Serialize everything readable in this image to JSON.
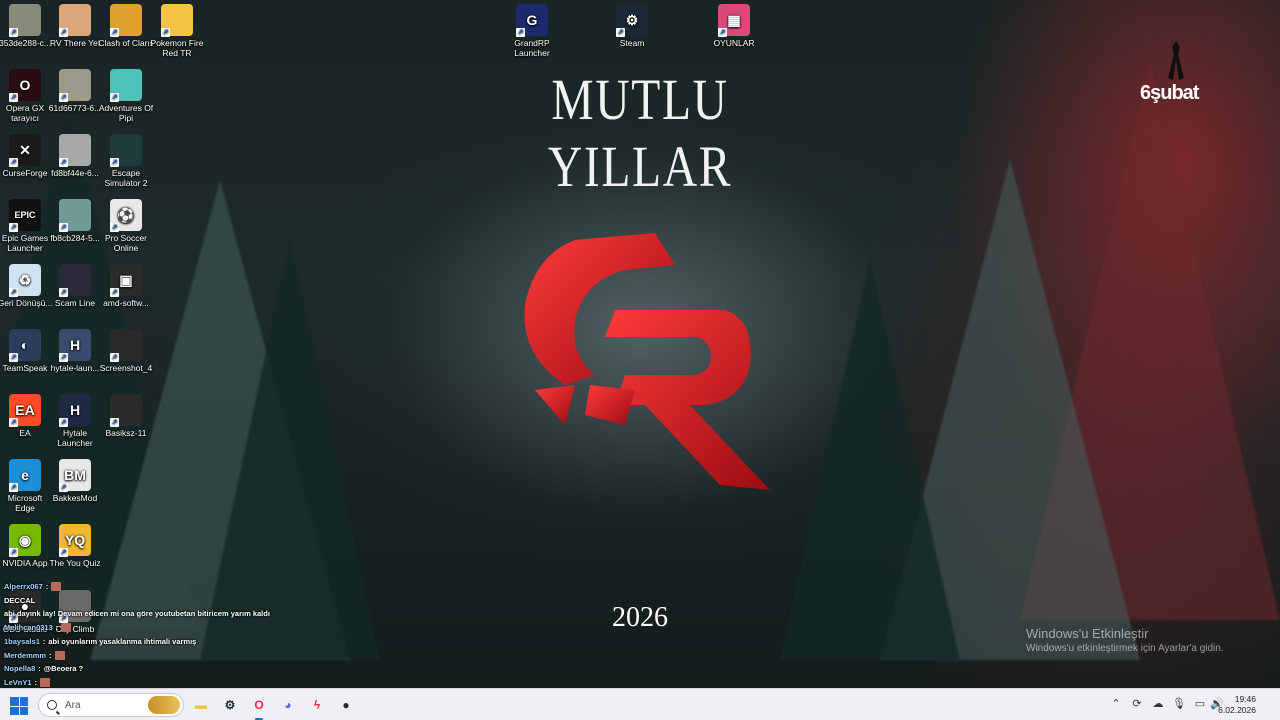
{
  "desktop": {
    "title": "MUTLU YILLAR",
    "year": "2026",
    "memorial": "6şubat",
    "activation": {
      "title": "Windows'u Etkinleştir",
      "subtitle": "Windows'u etkinleştirmek için Ayarlar'a gidin."
    },
    "icons": [
      {
        "label": "353de288-c...",
        "icon": "image-file-icon",
        "color": "#8a8a7a"
      },
      {
        "label": "RV There Yet",
        "icon": "rv-there-yet-icon",
        "color": "#d9a77a"
      },
      {
        "label": "Clash of Clans",
        "icon": "clash-of-clans-icon",
        "color": "#e0a030"
      },
      {
        "label": "Pokemon Fire Red TR",
        "icon": "folder-icon",
        "color": "#f3c443"
      },
      {
        "label": "Opera GX tarayıcı",
        "icon": "opera-gx-icon",
        "color": "#2a0d12"
      },
      {
        "label": "61d66773-6...",
        "icon": "image-file-icon",
        "color": "#9c9a8a"
      },
      {
        "label": "Adventures Of Pipi",
        "icon": "adventures-of-pipi-icon",
        "color": "#4cc2b8"
      },
      {
        "label": "CurseForge",
        "icon": "curseforge-icon",
        "color": "#1b1b1b"
      },
      {
        "label": "fd8bf44e-6...",
        "icon": "image-file-icon",
        "color": "#a8a8a8"
      },
      {
        "label": "Escape Simulator 2",
        "icon": "escape-simulator-icon",
        "color": "#1f3a3a"
      },
      {
        "label": "Epic Games Launcher",
        "icon": "epic-games-icon",
        "color": "#111111"
      },
      {
        "label": "fb8cb284-5...",
        "icon": "image-file-icon",
        "color": "#6f9a98"
      },
      {
        "label": "Pro Soccer Online",
        "icon": "soccer-ball-icon",
        "color": "#e8e8e8"
      },
      {
        "label": "Geri Dönüşü...",
        "icon": "recycle-bin-icon",
        "color": "#cfe3f2"
      },
      {
        "label": "Scam Line",
        "icon": "scam-line-icon",
        "color": "#2a2a3a"
      },
      {
        "label": "amd-softw...",
        "icon": "amd-installer-icon",
        "color": "#2b2b2b"
      },
      {
        "label": "TeamSpeak",
        "icon": "teamspeak-icon",
        "color": "#2b3d5a"
      },
      {
        "label": "hytale-laun...",
        "icon": "hytale-installer-icon",
        "color": "#3a4a6a"
      },
      {
        "label": "Screenshot_4",
        "icon": "image-file-icon",
        "color": "#2a2a2a"
      },
      {
        "label": "EA",
        "icon": "ea-icon",
        "color": "#ff4b26"
      },
      {
        "label": "Hytale Launcher",
        "icon": "hytale-icon",
        "color": "#1e2a44"
      },
      {
        "label": "Basiksz-11",
        "icon": "image-file-icon",
        "color": "#2a2a2a"
      },
      {
        "label": "Microsoft Edge",
        "icon": "edge-icon",
        "color": "#1d8fd8"
      },
      {
        "label": "BakkesMod",
        "icon": "bakkesmod-icon",
        "color": "#e8e8e8"
      },
      {
        "label": "NVIDIA App",
        "icon": "nvidia-icon",
        "color": "#76b900"
      },
      {
        "label": "The You Quiz",
        "icon": "you-quiz-icon",
        "color": "#f2b632"
      },
      {
        "label": "OBS Studio",
        "icon": "obs-icon",
        "color": "#2a2a2a"
      },
      {
        "label": "City Climb",
        "icon": "city-climb-icon",
        "color": "#6a6a6a"
      },
      {
        "label": "GrandRP Launcher",
        "icon": "grandrp-icon",
        "color": "#1a2a6a"
      },
      {
        "label": "Steam",
        "icon": "steam-icon",
        "color": "#1b2838"
      },
      {
        "label": "OYUNLAR",
        "icon": "oyunlar-folder-icon",
        "color": "#d94a7a"
      }
    ]
  },
  "chat": {
    "messages": [
      {
        "user": "Alperrx067",
        "text": ""
      },
      {
        "user": "",
        "text": "DECCAL"
      },
      {
        "user": "",
        "text": "abi dayınk lay! Devam edicen mi ona göre youtubetan bitiricem yarım kaldı"
      },
      {
        "user": "Melihcan0313",
        "text": ""
      },
      {
        "user": "1baysals1",
        "text": "abi oyunlarım yasaklanma ihtimali varmış"
      },
      {
        "user": "Merdemmm",
        "text": ""
      },
      {
        "user": "Nopella8",
        "text": "@Beoera ?"
      },
      {
        "user": "LeVnY1",
        "text": ""
      }
    ]
  },
  "taskbar": {
    "search_placeholder": "Ara",
    "apps": [
      {
        "name": "file-explorer",
        "icon": "folder-icon",
        "color": "#f3c443"
      },
      {
        "name": "steam",
        "icon": "steam-icon",
        "color": "#1b2838"
      },
      {
        "name": "opera-gx",
        "icon": "opera-gx-icon",
        "color": "#e0304a"
      },
      {
        "name": "discord",
        "icon": "discord-icon",
        "color": "#5865f2"
      },
      {
        "name": "quick-launch",
        "icon": "lightning-icon",
        "color": "#e8334a"
      },
      {
        "name": "obs-studio",
        "icon": "obs-icon",
        "color": "#2a2a2a"
      }
    ],
    "time": "19:46",
    "date": "6.02.2026"
  }
}
